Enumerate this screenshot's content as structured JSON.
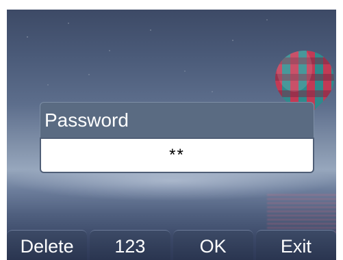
{
  "dialog": {
    "title": "Password",
    "value": "**"
  },
  "softkeys": [
    {
      "label": "Delete"
    },
    {
      "label": "123"
    },
    {
      "label": "OK"
    },
    {
      "label": "Exit"
    }
  ],
  "colors": {
    "sky_top": "#3d4a66",
    "dialog_title_bg": "#5a6b82",
    "softkey_bg": "#2a3550",
    "balloon_red": "#c23a55",
    "balloon_teal": "#2f8a8c"
  }
}
